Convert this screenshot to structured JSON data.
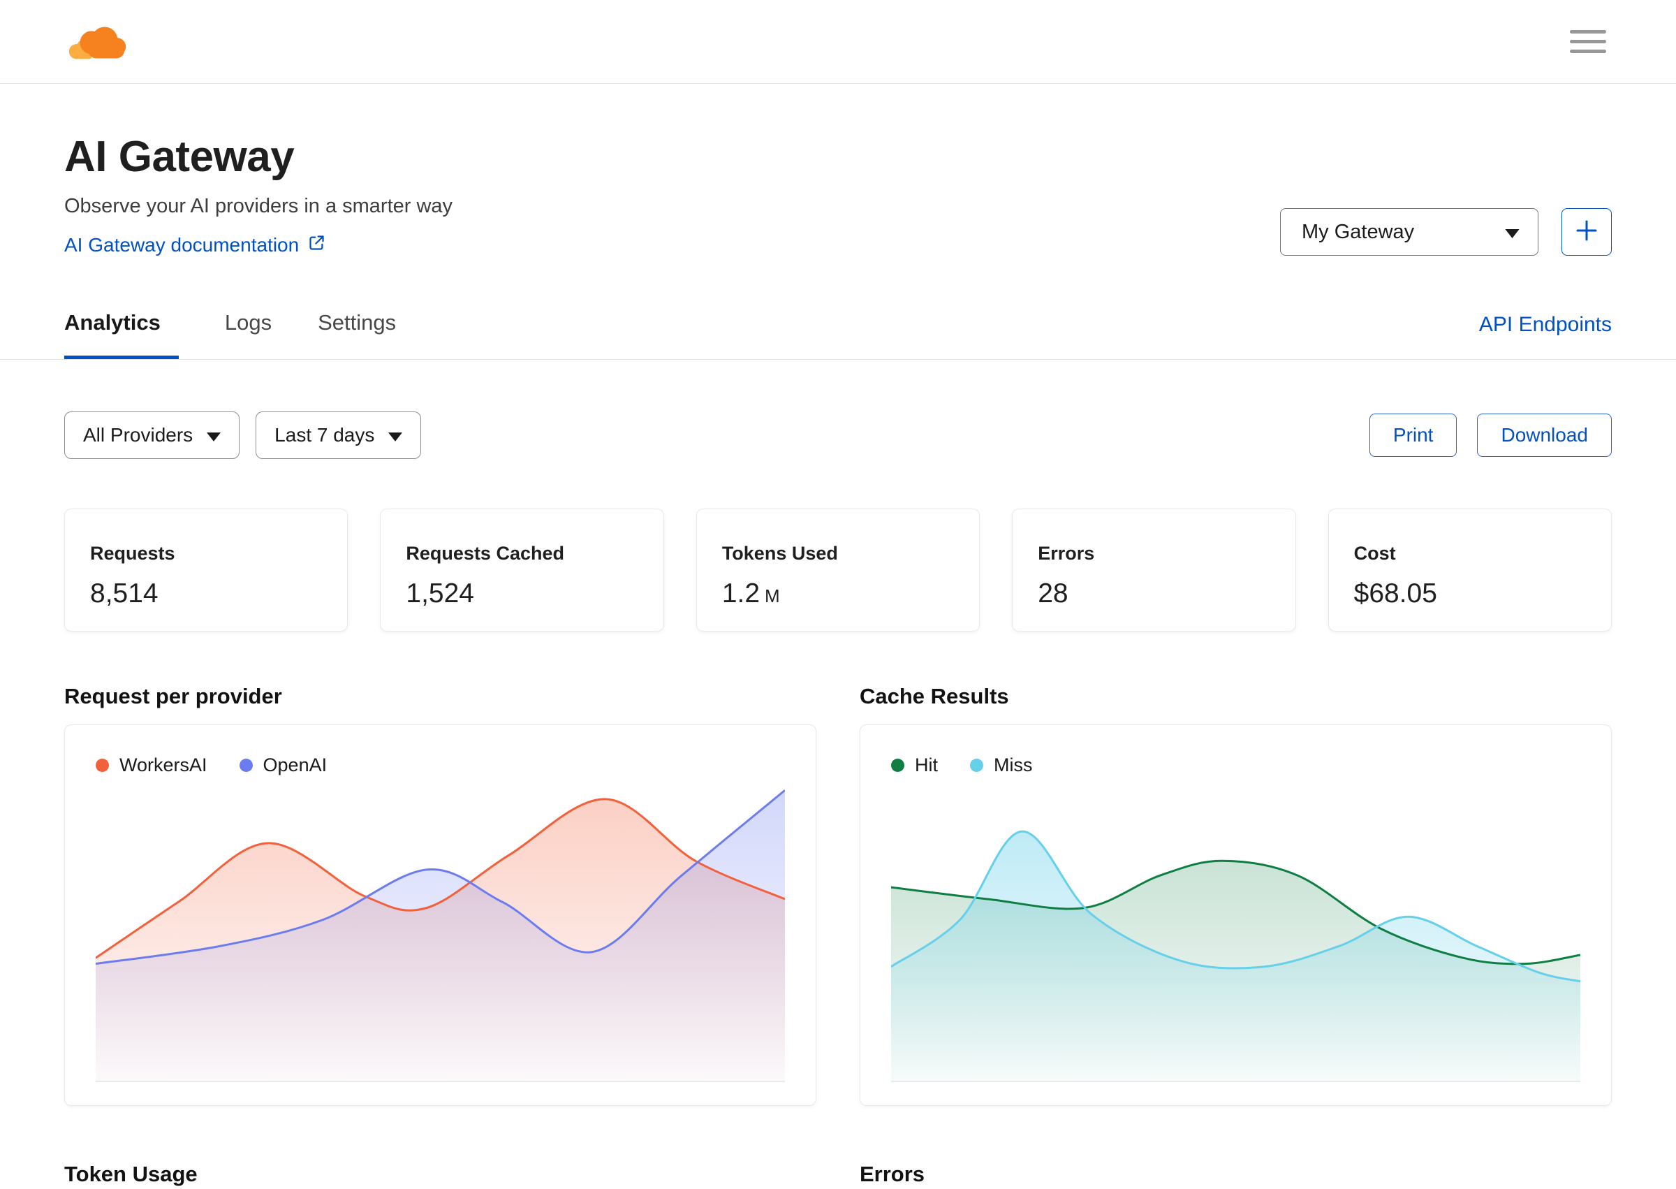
{
  "colors": {
    "accent_blue": "#0051C3",
    "brand_orange": "#F6821F",
    "brand_orange_light": "#FBAD41",
    "card_border": "#e9e9e9",
    "divider": "#e3e3e3"
  },
  "icons": {
    "logo": "cloudflare-logo",
    "menu": "hamburger",
    "external": "external-link",
    "caret": "chevron-down",
    "add": "plus"
  },
  "header": {
    "title": "AI Gateway",
    "subtitle": "Observe your AI providers in a smarter way",
    "doc_link_label": "AI Gateway documentation",
    "gateway_selector_value": "My Gateway"
  },
  "tabs": {
    "items": [
      {
        "label": "Analytics",
        "active": true
      },
      {
        "label": "Logs",
        "active": false
      },
      {
        "label": "Settings",
        "active": false
      }
    ],
    "api_endpoints_label": "API Endpoints"
  },
  "filters": {
    "provider_filter_value": "All Providers",
    "date_range_value": "Last 7 days",
    "print_label": "Print",
    "download_label": "Download"
  },
  "stats": {
    "items": [
      {
        "label": "Requests",
        "value": "8,514",
        "suffix": ""
      },
      {
        "label": "Requests Cached",
        "value": "1,524",
        "suffix": ""
      },
      {
        "label": "Tokens Used",
        "value": "1.2",
        "suffix": "M"
      },
      {
        "label": "Errors",
        "value": "28",
        "suffix": ""
      },
      {
        "label": "Cost",
        "value": "$68.05",
        "suffix": ""
      }
    ]
  },
  "chart_data": [
    {
      "type": "area",
      "title": "Request per provider",
      "legend_position": "top-left",
      "grid": false,
      "axis_tick_labels_visible": false,
      "point_units": "percent: [x across plot 0-100, y from top 0-100], baseline = 100",
      "series": [
        {
          "name": "WorkersAI",
          "color": "#F2613C",
          "fill_opacity": 0.3,
          "points": [
            [
              0,
              58
            ],
            [
              12,
              39
            ],
            [
              25,
              19
            ],
            [
              39,
              37
            ],
            [
              48,
              41
            ],
            [
              60,
              23
            ],
            [
              74,
              4
            ],
            [
              87,
              25
            ],
            [
              100,
              38
            ]
          ]
        },
        {
          "name": "OpenAI",
          "color": "#6B7CF0",
          "fill_opacity": 0.3,
          "points": [
            [
              0,
              60
            ],
            [
              18,
              54
            ],
            [
              33,
              45
            ],
            [
              48,
              28
            ],
            [
              59,
              39
            ],
            [
              72,
              56
            ],
            [
              85,
              30
            ],
            [
              100,
              1
            ]
          ]
        }
      ]
    },
    {
      "type": "area",
      "title": "Cache Results",
      "legend_position": "top-left",
      "grid": false,
      "axis_tick_labels_visible": false,
      "point_units": "percent: [x across plot 0-100, y from top 0-100], baseline = 100",
      "series": [
        {
          "name": "Hit",
          "color": "#0E7E43",
          "fill_opacity": 0.22,
          "points": [
            [
              0,
              34
            ],
            [
              14,
              38
            ],
            [
              28,
              41
            ],
            [
              39,
              30
            ],
            [
              48,
              25
            ],
            [
              59,
              30
            ],
            [
              71,
              48
            ],
            [
              83,
              58
            ],
            [
              92,
              60
            ],
            [
              100,
              57
            ]
          ]
        },
        {
          "name": "Miss",
          "color": "#66CFEA",
          "fill_opacity": 0.42,
          "points": [
            [
              0,
              61
            ],
            [
              10,
              45
            ],
            [
              19,
              15
            ],
            [
              29,
              43
            ],
            [
              42,
              59
            ],
            [
              54,
              61
            ],
            [
              65,
              54
            ],
            [
              75,
              44
            ],
            [
              85,
              54
            ],
            [
              94,
              63
            ],
            [
              100,
              66
            ]
          ]
        }
      ]
    }
  ],
  "bottom_sections": {
    "left_title": "Token Usage",
    "right_title": "Errors"
  }
}
